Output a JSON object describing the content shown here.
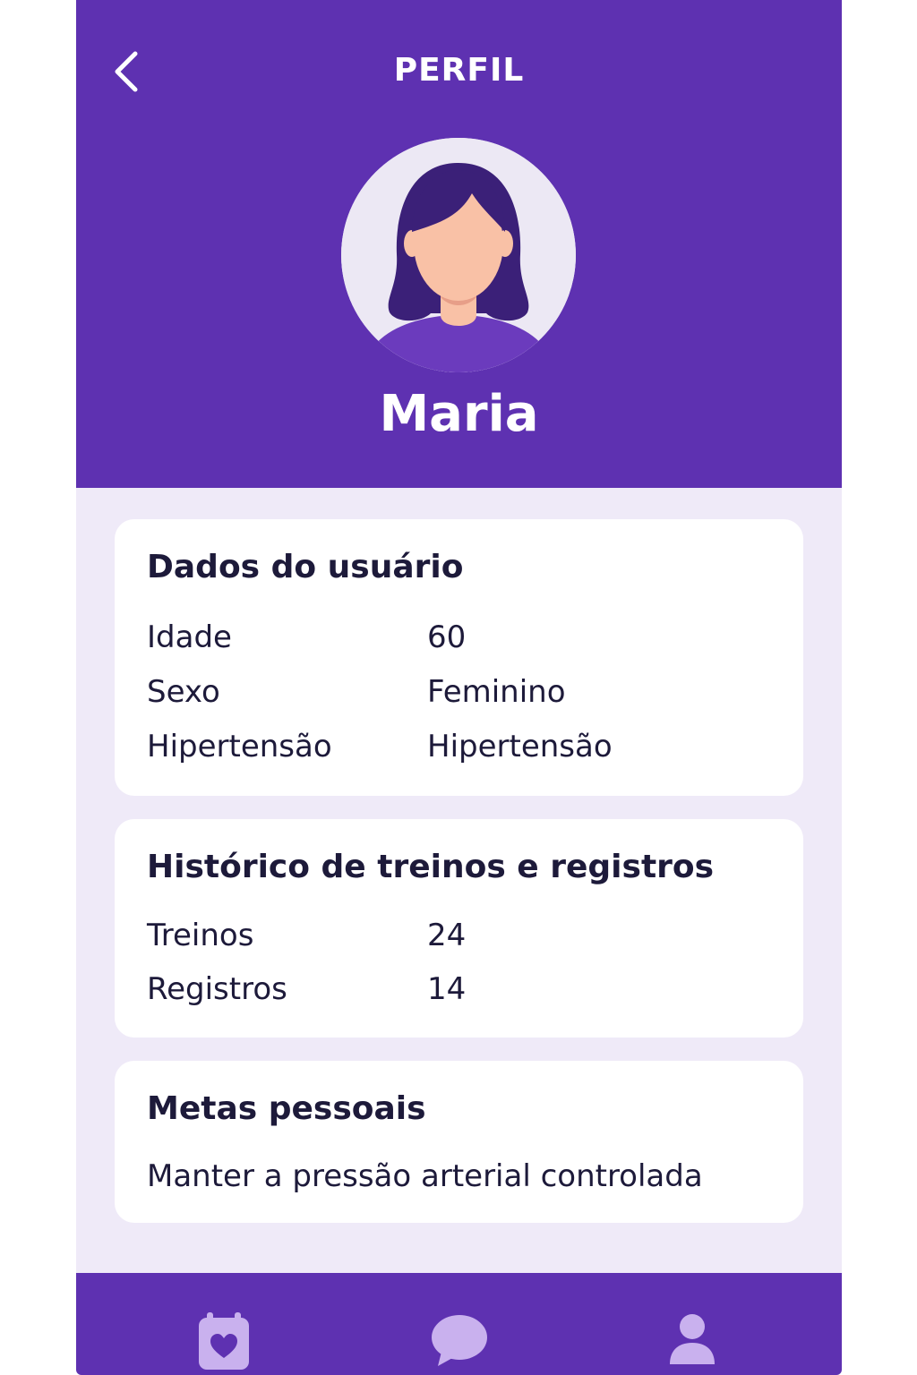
{
  "app": {
    "page_title": "PERFIL",
    "back_icon": "chevron-left-icon"
  },
  "profile": {
    "name": "Maria",
    "avatar": "woman-avatar-illustration"
  },
  "user_data": {
    "title": "Dados do usuário",
    "rows": [
      {
        "label": "Idade",
        "value": "60"
      },
      {
        "label": "Sexo",
        "value": "Feminino"
      },
      {
        "label": "Hipertensão",
        "value": "Hipertensão"
      }
    ]
  },
  "history": {
    "title": "Histórico de treinos e registros",
    "rows": [
      {
        "label": "Treinos",
        "value": "24"
      },
      {
        "label": "Registros",
        "value": "14"
      }
    ]
  },
  "goals": {
    "title": "Metas pessoais",
    "text": "Manter a pressão arterial controlada"
  },
  "bottom_nav": {
    "items": [
      {
        "icon": "calendar-heart-icon"
      },
      {
        "icon": "chat-bubble-icon"
      },
      {
        "icon": "user-profile-icon"
      }
    ]
  },
  "colors": {
    "primary": "#5e31b1",
    "background": "#efeaf8",
    "card": "#ffffff",
    "text": "#1d1a3a",
    "nav_icon": "#c9b1ee"
  }
}
